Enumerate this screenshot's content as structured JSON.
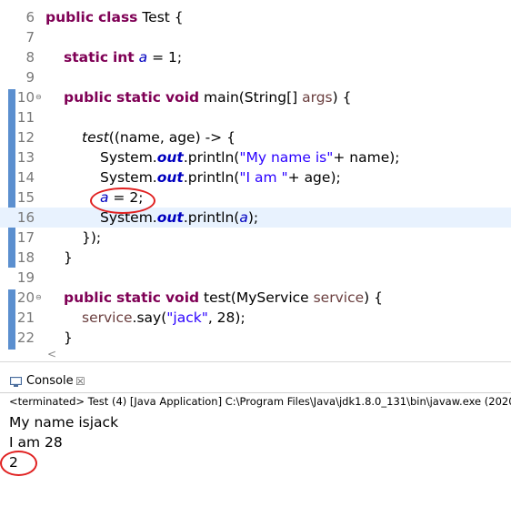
{
  "editor": {
    "lines": [
      {
        "num": "6"
      },
      {
        "num": "7"
      },
      {
        "num": "8",
        "init": "1"
      },
      {
        "num": "9"
      },
      {
        "num": "10"
      },
      {
        "num": "11"
      },
      {
        "num": "12"
      },
      {
        "num": "13"
      },
      {
        "num": "14"
      },
      {
        "num": "15"
      },
      {
        "num": "16"
      },
      {
        "num": "17"
      },
      {
        "num": "18"
      },
      {
        "num": "19"
      },
      {
        "num": "20"
      },
      {
        "num": "21"
      },
      {
        "num": "22"
      }
    ],
    "text": {
      "public": "public",
      "class": "class",
      "static": "static",
      "int": "int",
      "void": "void",
      "class_decl": " Test {",
      "field_a": "a",
      "field_init": " = 1;",
      "main_sig": " main(String[] ",
      "args": "args",
      "main_end": ") {",
      "test_call": "test",
      "lambda_open": "((",
      "name": "name",
      "comma": ", ",
      "age": "age",
      "lambda_arrow": ") -> {",
      "system": "System.",
      "out": "out",
      "println_open": ".println(",
      "str_name": "\"My name is\"",
      "plus_name": "+ ",
      "close_stmt": ");",
      "str_age": "\"I am \"",
      "plus_age": "+ ",
      "assign": " = 2;",
      "lambda_close": "});",
      "brace_close": "}",
      "test_sig": " test(MyService ",
      "service": "service",
      "test_sig_end": ") {",
      "service_call": "service",
      "say_open": ".say(",
      "str_jack": "\"jack\"",
      "say_end": ", 28);"
    }
  },
  "console": {
    "tab_title": "Console",
    "close_glyph": "☒",
    "terminated": "<terminated> Test (4) [Java Application] C:\\Program Files\\Java\\jdk1.8.0_131\\bin\\javaw.exe (2020",
    "output": [
      "My name isjack",
      "I am 28",
      "2"
    ]
  },
  "colors": {
    "keyword": "#7f0055",
    "static_field": "#0000c0",
    "string": "#2a00ff",
    "annotation_circle": "#e02020",
    "current_line": "#e8f2fe"
  }
}
